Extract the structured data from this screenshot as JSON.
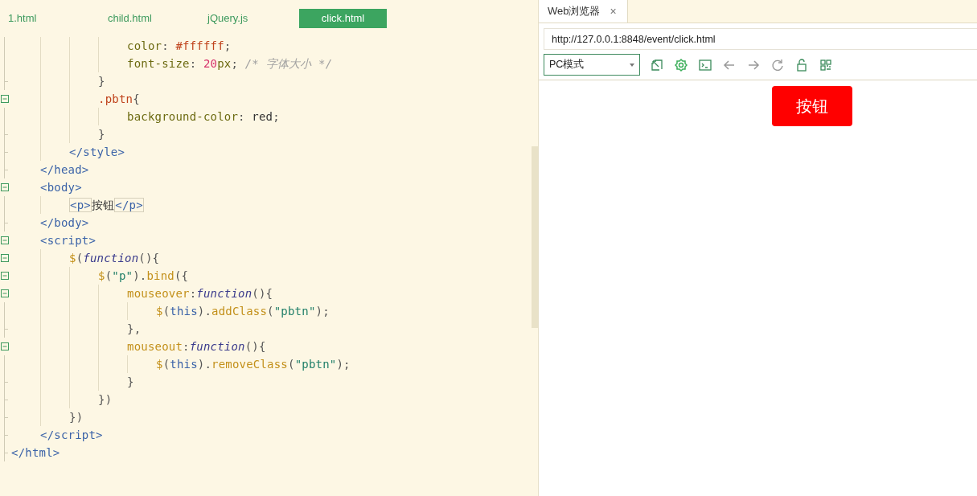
{
  "editor": {
    "tabs": [
      {
        "label": "1.html",
        "selected": false
      },
      {
        "label": "child.html",
        "selected": false
      },
      {
        "label": "jQuery.js",
        "selected": false
      },
      {
        "label": "click.html",
        "selected": true
      }
    ],
    "lines": [
      {
        "children": [
          {
            "children": [
              {
                "children": [
                  {
                    "children": [
                      {
                        "fold_end": false,
                        "tokens": [
                          {
                            "text": "color",
                            "kind": "prop"
                          },
                          {
                            "text": ": ",
                            "kind": "punct"
                          },
                          {
                            "text": "#ffffff",
                            "kind": "val"
                          },
                          {
                            "text": ";",
                            "kind": "punct"
                          }
                        ]
                      },
                      {
                        "fold_end": false,
                        "tokens": [
                          {
                            "text": "font-size",
                            "kind": "prop"
                          },
                          {
                            "text": ": ",
                            "kind": "punct"
                          },
                          {
                            "text": "20",
                            "kind": "num"
                          },
                          {
                            "text": "px",
                            "kind": "prop"
                          },
                          {
                            "text": "; ",
                            "kind": "punct"
                          },
                          {
                            "text": "/* 字体大小 */",
                            "kind": "comment"
                          }
                        ]
                      }
                    ]
                  },
                  {
                    "fold_end": true,
                    "tokens": [
                      {
                        "text": "}",
                        "kind": "punct"
                      }
                    ]
                  },
                  {
                    "tokens": [
                      {
                        "text": ".pbtn",
                        "kind": "val"
                      },
                      {
                        "text": "{",
                        "kind": "punct"
                      }
                    ],
                    "children": [
                      {
                        "fold_end": false,
                        "tokens": [
                          {
                            "text": "background-color",
                            "kind": "prop"
                          },
                          {
                            "text": ": ",
                            "kind": "punct"
                          },
                          {
                            "text": "red",
                            "kind": "plain"
                          },
                          {
                            "text": ";",
                            "kind": "punct"
                          }
                        ]
                      }
                    ]
                  },
                  {
                    "fold_end": true,
                    "tokens": [
                      {
                        "text": "}",
                        "kind": "punct"
                      }
                    ]
                  }
                ]
              },
              {
                "fold_end": true,
                "tokens": [
                  {
                    "text": "</style>",
                    "kind": "tag"
                  }
                ]
              }
            ]
          },
          {
            "fold_end": true,
            "tokens": [
              {
                "text": "</head>",
                "kind": "tag"
              }
            ]
          },
          {
            "tokens": [
              {
                "text": "<body>",
                "kind": "tag"
              }
            ],
            "children": [
              {
                "fold_end": false,
                "tokens": [
                  {
                    "text": "<p>",
                    "kind": "tagmatch"
                  },
                  {
                    "text": "按钮",
                    "kind": "plain"
                  },
                  {
                    "text": "</p>",
                    "kind": "tagmatch"
                  }
                ]
              }
            ]
          },
          {
            "fold_end": true,
            "tokens": [
              {
                "text": "</body>",
                "kind": "tag"
              }
            ]
          },
          {
            "tokens": [
              {
                "text": "<script>",
                "kind": "tag"
              }
            ],
            "children": [
              {
                "tokens": [
                  {
                    "text": "$",
                    "kind": "method"
                  },
                  {
                    "text": "(",
                    "kind": "punct"
                  },
                  {
                    "text": "function",
                    "kind": "kw"
                  },
                  {
                    "text": "(){",
                    "kind": "punct"
                  }
                ],
                "children": [
                  {
                    "tokens": [
                      {
                        "text": "$",
                        "kind": "method"
                      },
                      {
                        "text": "(",
                        "kind": "punct"
                      },
                      {
                        "text": "\"p\"",
                        "kind": "str"
                      },
                      {
                        "text": ").",
                        "kind": "punct"
                      },
                      {
                        "text": "bind",
                        "kind": "method"
                      },
                      {
                        "text": "({",
                        "kind": "punct"
                      }
                    ],
                    "children": [
                      {
                        "tokens": [
                          {
                            "text": "mouseover",
                            "kind": "method"
                          },
                          {
                            "text": ":",
                            "kind": "punct"
                          },
                          {
                            "text": "function",
                            "kind": "kw"
                          },
                          {
                            "text": "(){",
                            "kind": "punct"
                          }
                        ],
                        "children": [
                          {
                            "fold_end": false,
                            "tokens": [
                              {
                                "text": "$",
                                "kind": "method"
                              },
                              {
                                "text": "(",
                                "kind": "punct"
                              },
                              {
                                "text": "this",
                                "kind": "tag"
                              },
                              {
                                "text": ").",
                                "kind": "punct"
                              },
                              {
                                "text": "addClass",
                                "kind": "method"
                              },
                              {
                                "text": "(",
                                "kind": "punct"
                              },
                              {
                                "text": "\"pbtn\"",
                                "kind": "str"
                              },
                              {
                                "text": ");",
                                "kind": "punct"
                              }
                            ]
                          }
                        ]
                      },
                      {
                        "fold_end": true,
                        "tokens": [
                          {
                            "text": "},",
                            "kind": "punct"
                          }
                        ]
                      },
                      {
                        "tokens": [
                          {
                            "text": "mouseout",
                            "kind": "method"
                          },
                          {
                            "text": ":",
                            "kind": "punct"
                          },
                          {
                            "text": "function",
                            "kind": "kw"
                          },
                          {
                            "text": "(){",
                            "kind": "punct"
                          }
                        ],
                        "children": [
                          {
                            "fold_end": false,
                            "tokens": [
                              {
                                "text": "$",
                                "kind": "method"
                              },
                              {
                                "text": "(",
                                "kind": "punct"
                              },
                              {
                                "text": "this",
                                "kind": "tag"
                              },
                              {
                                "text": ").",
                                "kind": "punct"
                              },
                              {
                                "text": "removeClass",
                                "kind": "method"
                              },
                              {
                                "text": "(",
                                "kind": "punct"
                              },
                              {
                                "text": "\"pbtn\"",
                                "kind": "str"
                              },
                              {
                                "text": ");",
                                "kind": "punct"
                              }
                            ]
                          }
                        ]
                      },
                      {
                        "fold_end": true,
                        "tokens": [
                          {
                            "text": "}",
                            "kind": "punct"
                          }
                        ]
                      }
                    ]
                  },
                  {
                    "fold_end": true,
                    "tokens": [
                      {
                        "text": "})",
                        "kind": "punct"
                      }
                    ]
                  }
                ]
              },
              {
                "fold_end": true,
                "tokens": [
                  {
                    "text": "})",
                    "kind": "punct"
                  }
                ]
              }
            ]
          },
          {
            "fold_end": true,
            "tokens": [
              {
                "text": "</script>",
                "kind": "tag"
              }
            ]
          }
        ]
      },
      {
        "fold_end": true,
        "tokens": [
          {
            "text": "</html>",
            "kind": "tag"
          }
        ]
      }
    ]
  },
  "browser": {
    "tab": {
      "title": "Web浏览器",
      "close": "×"
    },
    "address": "http://127.0.0.1:8848/event/click.html",
    "mode_select": "PC模式",
    "page": {
      "button": "按钮"
    }
  }
}
